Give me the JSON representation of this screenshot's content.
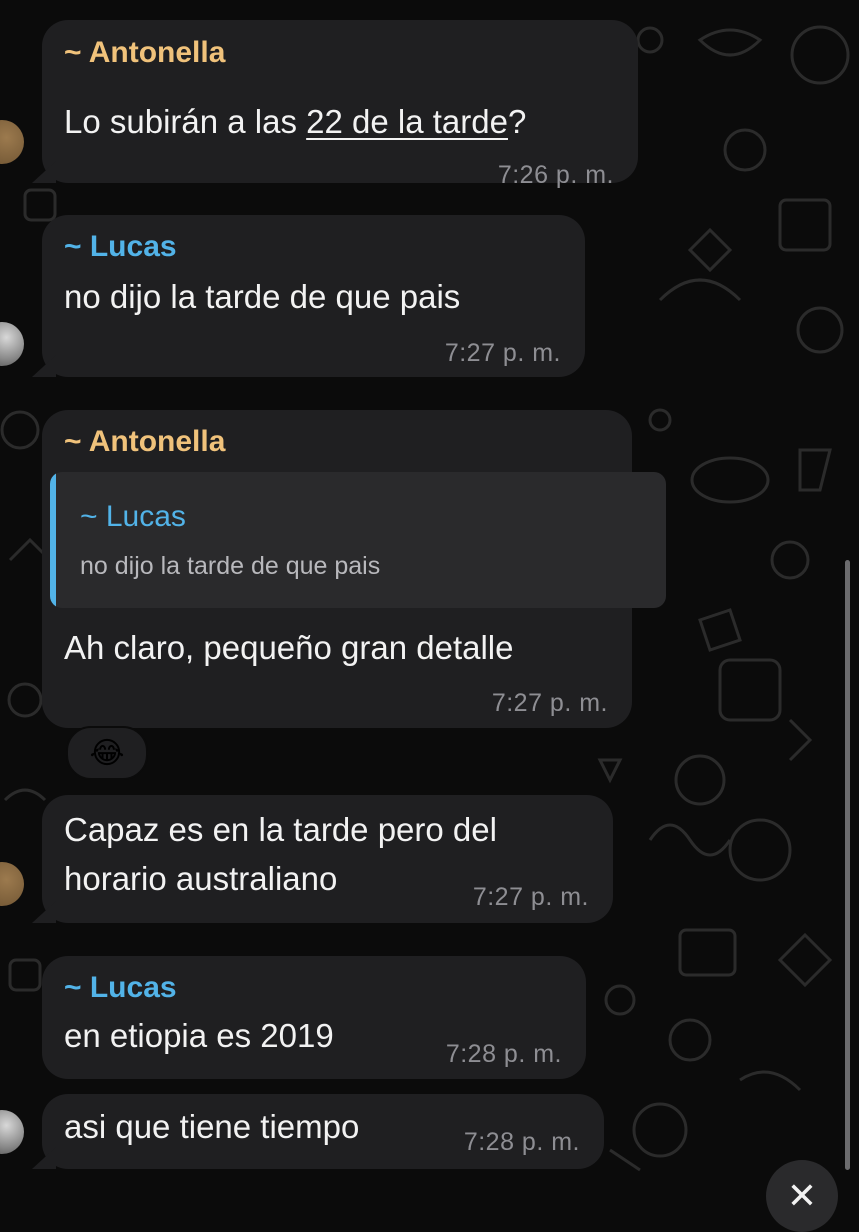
{
  "messages": [
    {
      "sender": "~ Antonella",
      "text_pre": "Lo subirán a las ",
      "text_link": "22 de la tarde",
      "text_post": "?",
      "time": "7:26 p. m."
    },
    {
      "sender": "~ Lucas",
      "text": "no dijo la tarde de que pais",
      "time": "7:27 p. m."
    },
    {
      "sender": "~ Antonella",
      "quote_sender": "~ Lucas",
      "quote_text": "no dijo la tarde de que pais",
      "text": "Ah claro, pequeño gran detalle",
      "time": "7:27 p. m.",
      "reaction": "😂"
    },
    {
      "text_line1": "Capaz es en la tarde pero del",
      "text_line2": "horario australiano",
      "time": "7:27 p. m."
    },
    {
      "sender": "~ Lucas",
      "text": "en etiopia es 2019",
      "time": "7:28 p. m."
    },
    {
      "text": "asi que tiene tiempo",
      "time": "7:28 p. m."
    }
  ],
  "controls": {
    "close_icon": "close-icon",
    "close_glyph": "✕"
  },
  "colors": {
    "background": "#0b0b0b",
    "bubble": "#1f1f21",
    "name_orange": "#f0c27b",
    "name_blue": "#52b3e8",
    "time": "#8e8e93"
  }
}
